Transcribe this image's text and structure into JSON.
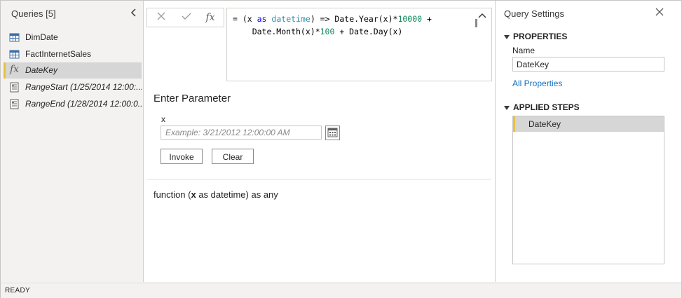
{
  "queries_pane": {
    "header": "Queries [5]",
    "items": [
      {
        "label": "DimDate",
        "icon": "table-icon",
        "italic": false,
        "selected": false
      },
      {
        "label": "FactInternetSales",
        "icon": "table-icon",
        "italic": false,
        "selected": false
      },
      {
        "label": "DateKey",
        "icon": "function-icon",
        "italic": true,
        "selected": true
      },
      {
        "label": "RangeStart (1/25/2014 12:00:...",
        "icon": "parameter-icon",
        "italic": true,
        "selected": false
      },
      {
        "label": "RangeEnd (1/28/2014 12:00:0...",
        "icon": "parameter-icon",
        "italic": true,
        "selected": false
      }
    ]
  },
  "formula_bar": {
    "fx_label": "fx",
    "line1_a": "= (x ",
    "line1_kw": "as",
    "line1_b": " ",
    "line1_type": "datetime",
    "line1_c": ") => Date.Year(x)*",
    "line1_num": "10000",
    "line1_d": " +",
    "line2_a": "    Date.Month(x)*",
    "line2_num": "100",
    "line2_b": " + Date.Day(x)"
  },
  "parameter": {
    "title": "Enter Parameter",
    "param_name": "x",
    "placeholder": "Example: 3/21/2012 12:00:00 AM",
    "invoke_label": "Invoke",
    "clear_label": "Clear"
  },
  "function_signature": {
    "prefix": "function (",
    "param": "x",
    "suffix": " as datetime) as any"
  },
  "query_settings": {
    "title": "Query Settings",
    "properties_header": "PROPERTIES",
    "name_label": "Name",
    "name_value": "DateKey",
    "all_properties_link": "All Properties",
    "applied_steps_header": "APPLIED STEPS",
    "steps": [
      "DateKey"
    ]
  },
  "status_bar": {
    "text": "READY"
  },
  "colors": {
    "accent_selected": "#e8c13d",
    "link": "#106ebe",
    "keyword": "#0000ff",
    "number": "#098658",
    "type": "#2b91af"
  }
}
